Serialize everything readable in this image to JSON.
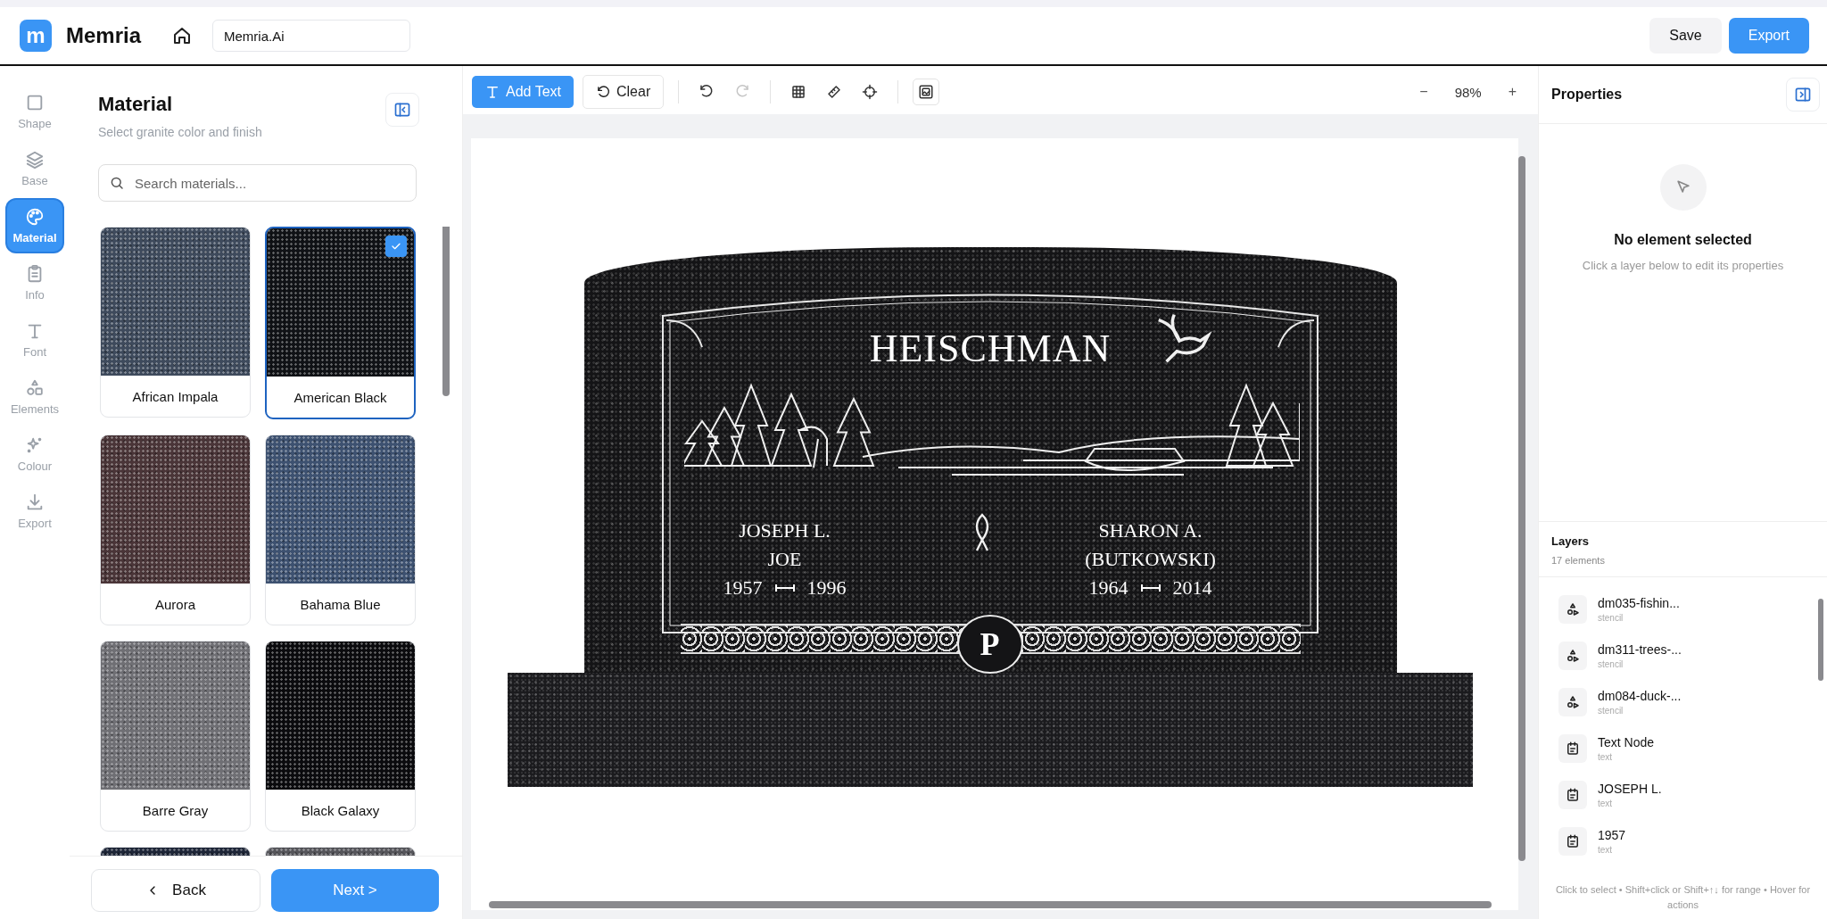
{
  "header": {
    "logo_letter": "m",
    "app_name": "Memria",
    "project_name": "Memria.Ai",
    "buttons": [
      {
        "label": "Save",
        "kind": "secondary"
      },
      {
        "label": "Export",
        "kind": "primary"
      }
    ]
  },
  "rail": [
    {
      "label": "Shape",
      "kind": "square",
      "selected": false
    },
    {
      "label": "Base",
      "kind": "layers",
      "selected": false
    },
    {
      "label": "Material",
      "kind": "palette",
      "selected": true
    },
    {
      "label": "Info",
      "kind": "clipboard",
      "selected": false
    },
    {
      "label": "Font",
      "kind": "type",
      "selected": false
    },
    {
      "label": "Elements",
      "kind": "shapes",
      "selected": false
    },
    {
      "label": "Colour",
      "kind": "sparkle",
      "selected": false
    },
    {
      "label": "Export",
      "kind": "download",
      "selected": false
    }
  ],
  "material_panel": {
    "title": "Material",
    "subtitle": "Select granite color and finish",
    "search": {
      "placeholder": "Search materials..."
    },
    "materials": [
      {
        "name": "African Impala",
        "color": "#3e4a5c",
        "selected": false
      },
      {
        "name": "American Black",
        "color": "#101216",
        "selected": true
      },
      {
        "name": "Aurora",
        "color": "#4a3538",
        "selected": false
      },
      {
        "name": "Bahama Blue",
        "color": "#3d5170",
        "selected": false
      },
      {
        "name": "Barre Gray",
        "color": "#6f6f74",
        "selected": false
      },
      {
        "name": "Black Galaxy",
        "color": "#0b0b0e",
        "selected": false
      },
      {
        "color": "#1e2638",
        "selected": false
      },
      {
        "color": "#55555a",
        "selected": false
      }
    ],
    "back": "Back",
    "next": "Next >"
  },
  "toolbar": {
    "add_text": "Add Text",
    "clear": "Clear",
    "tools": [
      {
        "kind": "undo",
        "disabled": false
      },
      {
        "kind": "redo",
        "disabled": true
      },
      {
        "kind": "grid",
        "disabled": false
      },
      {
        "kind": "ruler",
        "disabled": false
      },
      {
        "kind": "crosshair",
        "disabled": false
      },
      {
        "kind": "image",
        "disabled": false
      }
    ],
    "zoom_out": "−",
    "zoom": "98%",
    "zoom_in": "+"
  },
  "monument": {
    "surname": "HEISCHMAN",
    "monogram": "P",
    "people": [
      {
        "lines": [
          "JOSEPH L.",
          "JOE"
        ],
        "born": "1957",
        "died": "1996"
      },
      {
        "lines": [
          "SHARON A.",
          "(BUTKOWSKI)"
        ],
        "born": "1964",
        "died": "2014"
      }
    ]
  },
  "properties": {
    "title": "Properties",
    "empty_title": "No element selected",
    "empty_hint": "Click a layer below to edit its properties"
  },
  "layers": {
    "title": "Layers",
    "count": "17 elements",
    "items": [
      {
        "name": "dm035-fishin...",
        "kind": "stencil",
        "type": "stencil"
      },
      {
        "name": "dm311-trees-...",
        "kind": "stencil",
        "type": "stencil"
      },
      {
        "name": "dm084-duck-...",
        "kind": "stencil",
        "type": "stencil"
      },
      {
        "name": "Text Node",
        "kind": "text",
        "type": "text"
      },
      {
        "name": "JOSEPH L.",
        "kind": "text",
        "type": "text"
      },
      {
        "name": "1957",
        "kind": "text",
        "type": "text"
      }
    ],
    "hint": "Click to select • Shift+click or Shift+↑↓ for range • Hover for actions"
  }
}
